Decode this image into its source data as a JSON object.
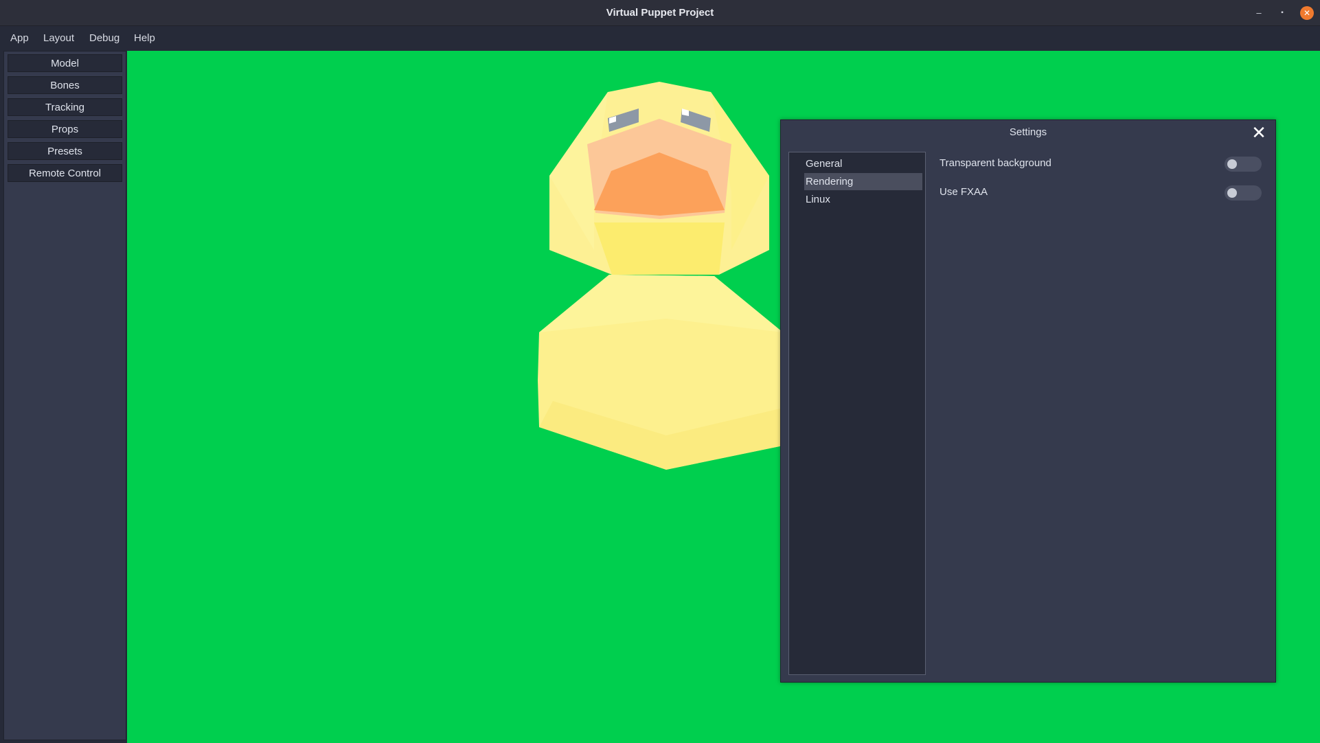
{
  "window": {
    "title": "Virtual Puppet Project",
    "minimize_glyph": "–",
    "maximize_glyph": "▪",
    "close_glyph": "✕"
  },
  "menu": [
    "App",
    "Layout",
    "Debug",
    "Help"
  ],
  "sidebar": {
    "items": [
      "Model",
      "Bones",
      "Tracking",
      "Props",
      "Presets",
      "Remote Control"
    ]
  },
  "viewport": {
    "background_color": "#00cf4e",
    "model": "duck"
  },
  "settings": {
    "title": "Settings",
    "close_glyph": "✕",
    "tabs": [
      "General",
      "Rendering",
      "Linux"
    ],
    "active_tab": "Rendering",
    "options": [
      {
        "label": "Transparent background",
        "enabled": false
      },
      {
        "label": "Use FXAA",
        "enabled": false
      }
    ]
  }
}
